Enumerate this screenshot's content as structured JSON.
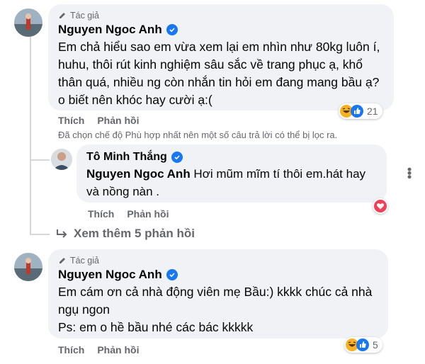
{
  "comments": [
    {
      "author_badge": "Tác giả",
      "author": "Nguyen Ngoc Anh",
      "text": "Em chả hiểu sao em vừa xem lại em nhìn như 80kg luôn í, huhu, thôi rút kinh nghiệm sâu sắc về trang phục ạ, khổ thân quá, nhiều ng còn nhắn tin hỏi em đang mang bầu ạ? o biết nên khóc hay cười ạ:(",
      "like_label": "Thích",
      "reply_label": "Phản hồi",
      "reaction_count": "21",
      "reaction_icons": [
        "haha-icon",
        "like-icon"
      ]
    },
    {
      "author_badge": "Tác giả",
      "author": "Nguyen Ngoc Anh",
      "text": "Em cám ơn cả nhà động viên mẹ Bầu:) kkkk chúc cả nhà ngụ ngon\nPs: em o hề bầu nhé các bác kkkkk",
      "like_label": "Thích",
      "reply_label": "Phản hồi",
      "reaction_count": "5",
      "reaction_icons": [
        "haha-icon",
        "like-icon"
      ]
    }
  ],
  "filter_notice": "Đã chọn chế độ Phù hợp nhất nên một số câu trả lời có thể bị lọc ra.",
  "reply": {
    "author": "Tô Minh Thắng",
    "mention": "Nguyen Ngoc Anh",
    "text": " Hơi mũm mĩm tí thôi em.hát hay và nồng nàn .",
    "like_label": "Thích",
    "reply_label": "Phản hồi",
    "reaction_icon": "love-icon"
  },
  "more_replies": "Xem thêm 5 phản hồi",
  "colors": {
    "verified": "#1877f2",
    "bubble": "#f0f2f5",
    "secondary_text": "#65676b",
    "love": "#f33e58",
    "like": "#1877f2",
    "haha": "#f7b125"
  }
}
